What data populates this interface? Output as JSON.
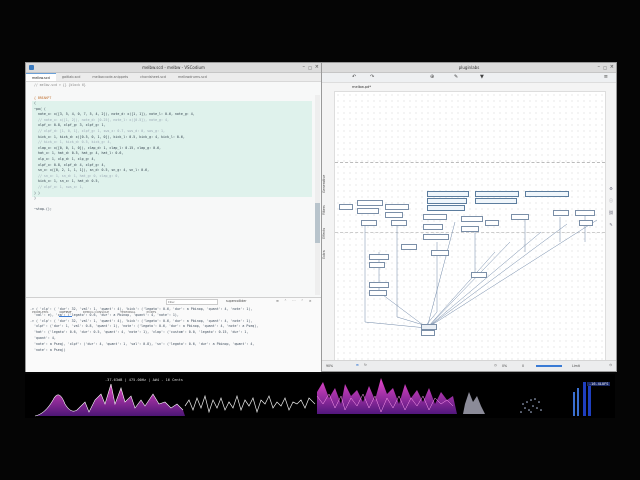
{
  "editor": {
    "title": "melbw.scd - melbw - VSCodium",
    "tabs": [
      "melbw.scd",
      "gaitlab.scd",
      "melbw.code-snippets",
      "chordsheet.scd",
      "melbwdrums.scd"
    ],
    "breadcrumb": "// melbw.scd > {} {block 6}",
    "block_label": "{ BREAKPT",
    "code_lines": [
      {
        "t": "(",
        "c": false
      },
      {
        "t": "~po( (",
        "c": false
      },
      {
        "t": "  note_x: x([3, 5, 4, 0, 7, 5, 4, 2]), note_d: x([1, 1]), note_l: 0.6, note_g: 4,",
        "c": false
      },
      {
        "t": "  // note_x: x([1, 2]), note_d: [0.25], note_l: x([0.5]), note_g: 4,",
        "c": true
      },
      {
        "t": "  xlpf_x: 0.8, xlpf_g: 3, xlpf_g: 1,",
        "c": false
      },
      {
        "t": "  // xlpf_d: [1, 0, 1], xlpf_g: 1, sws_x: 0.7, sws_d: 0, sws_g: 1,",
        "c": true
      },
      {
        "t": "  kick_x: 1, kick_d: x([0.5, 0, 1, 0]), kick_l: 0.5, kick_g: 4, kick_l: 0.6,",
        "c": false
      },
      {
        "t": "  // kick_x: 1, kick_d: 0.5, kick_g: 4,",
        "c": true
      },
      {
        "t": "  clap_x: x([0, 0, 1, 0]), clap_d: 1, clap_l: 0.15, clap_g: 0.6,",
        "c": false
      },
      {
        "t": "  hat_x: 1, hat_d: 0.5, hat_g: 4, hat_l: 0.6,",
        "c": false
      },
      {
        "t": "  xlp_x: 1, xlp_d: 1, xlp_g: 4,",
        "c": false
      },
      {
        "t": "  xlpf_x: 0.8, xlpf_d: 4, xlpf_g: 4,",
        "c": false
      },
      {
        "t": "  sn_x: x([0, 2, 1, 1, 1]), sn_d: 0.5, sn_g: 4, sn_l: 0.6,",
        "c": false
      },
      {
        "t": "  // sn_x: 1, sn_d: 1, hat_g: 0, clap_g: 0,",
        "c": true
      },
      {
        "t": "  kick_x: 1, sn_x: 1, hat_d: 0.5,",
        "c": false
      },
      {
        "t": "  // xlpf_x: 1, sws_x: 1,",
        "c": true
      },
      {
        "t": ") )",
        "c": false
      },
      {
        "t": ")",
        "c": false
      },
      {
        "t": "",
        "c": false
      },
      {
        "t": "~stop.();",
        "c": false
      }
    ],
    "panel_tabs": [
      "PROBLEMS",
      "OUTPUT",
      "DEBUG CONSOLE",
      "TERMINAL",
      "PORTS"
    ],
    "panel_filter_placeholder": "Filter",
    "panel_source": "supercollider",
    "output_lines": [
      "-> ( 'clp': ( 'dur': 32, 'val': 1, 'quant': 4), 'kick': ('legato': 0.6, 'dur': a Pbinop, 'quant': 4, 'note': 1),",
      "  'val': e), 'xa': ('legato': 0.6, 'dur': a Pbinop, 'quant': 4, 'note': 1),",
      "",
      "-> ( 'clp': ( 'dur': 32, 'val': 1, 'quant': 4), 'kick': ('legato': 0.6, 'dur': a Pbinop, 'quant': 4, 'note': 1),",
      "  'xlpf': ('dur': 1, 'val': 0.8, 'quant': 1), 'note': ('legato': 0.6, 'dur': a Pbinop, 'quant': 4, 'note': a Pseq),",
      "  'hat': ('legato': 0.6, 'dur': 0.5, 'quant': 4, 'note': 1), 'clap': ('custom': 0.0, 'legato': 0.15, 'dur': 1,",
      "  'quant': 4,",
      "  'note': a Pseq), 'xlpf': ('dur': 4, 'quant': 1, 'val': 0.8), 'sn': ('legato': 0.6, 'dur': a Pbinop, 'quant': 4,",
      "  'note': a Pseq))"
    ]
  },
  "pd": {
    "title": "pluginlabs",
    "file_title": "melbw.pd*",
    "side_tabs": [
      "Generative",
      "Filters",
      "Effects",
      "Extra"
    ],
    "zoom": "90%",
    "status_right": "Limit",
    "value_left": "0%",
    "value_mid": "0",
    "accent": "#3a7bd5"
  },
  "analyzer": {
    "readout": "-37.63dB | 475.00Hz | A#4 - 16 Cents",
    "meter_label": "-16.4LUFS"
  }
}
